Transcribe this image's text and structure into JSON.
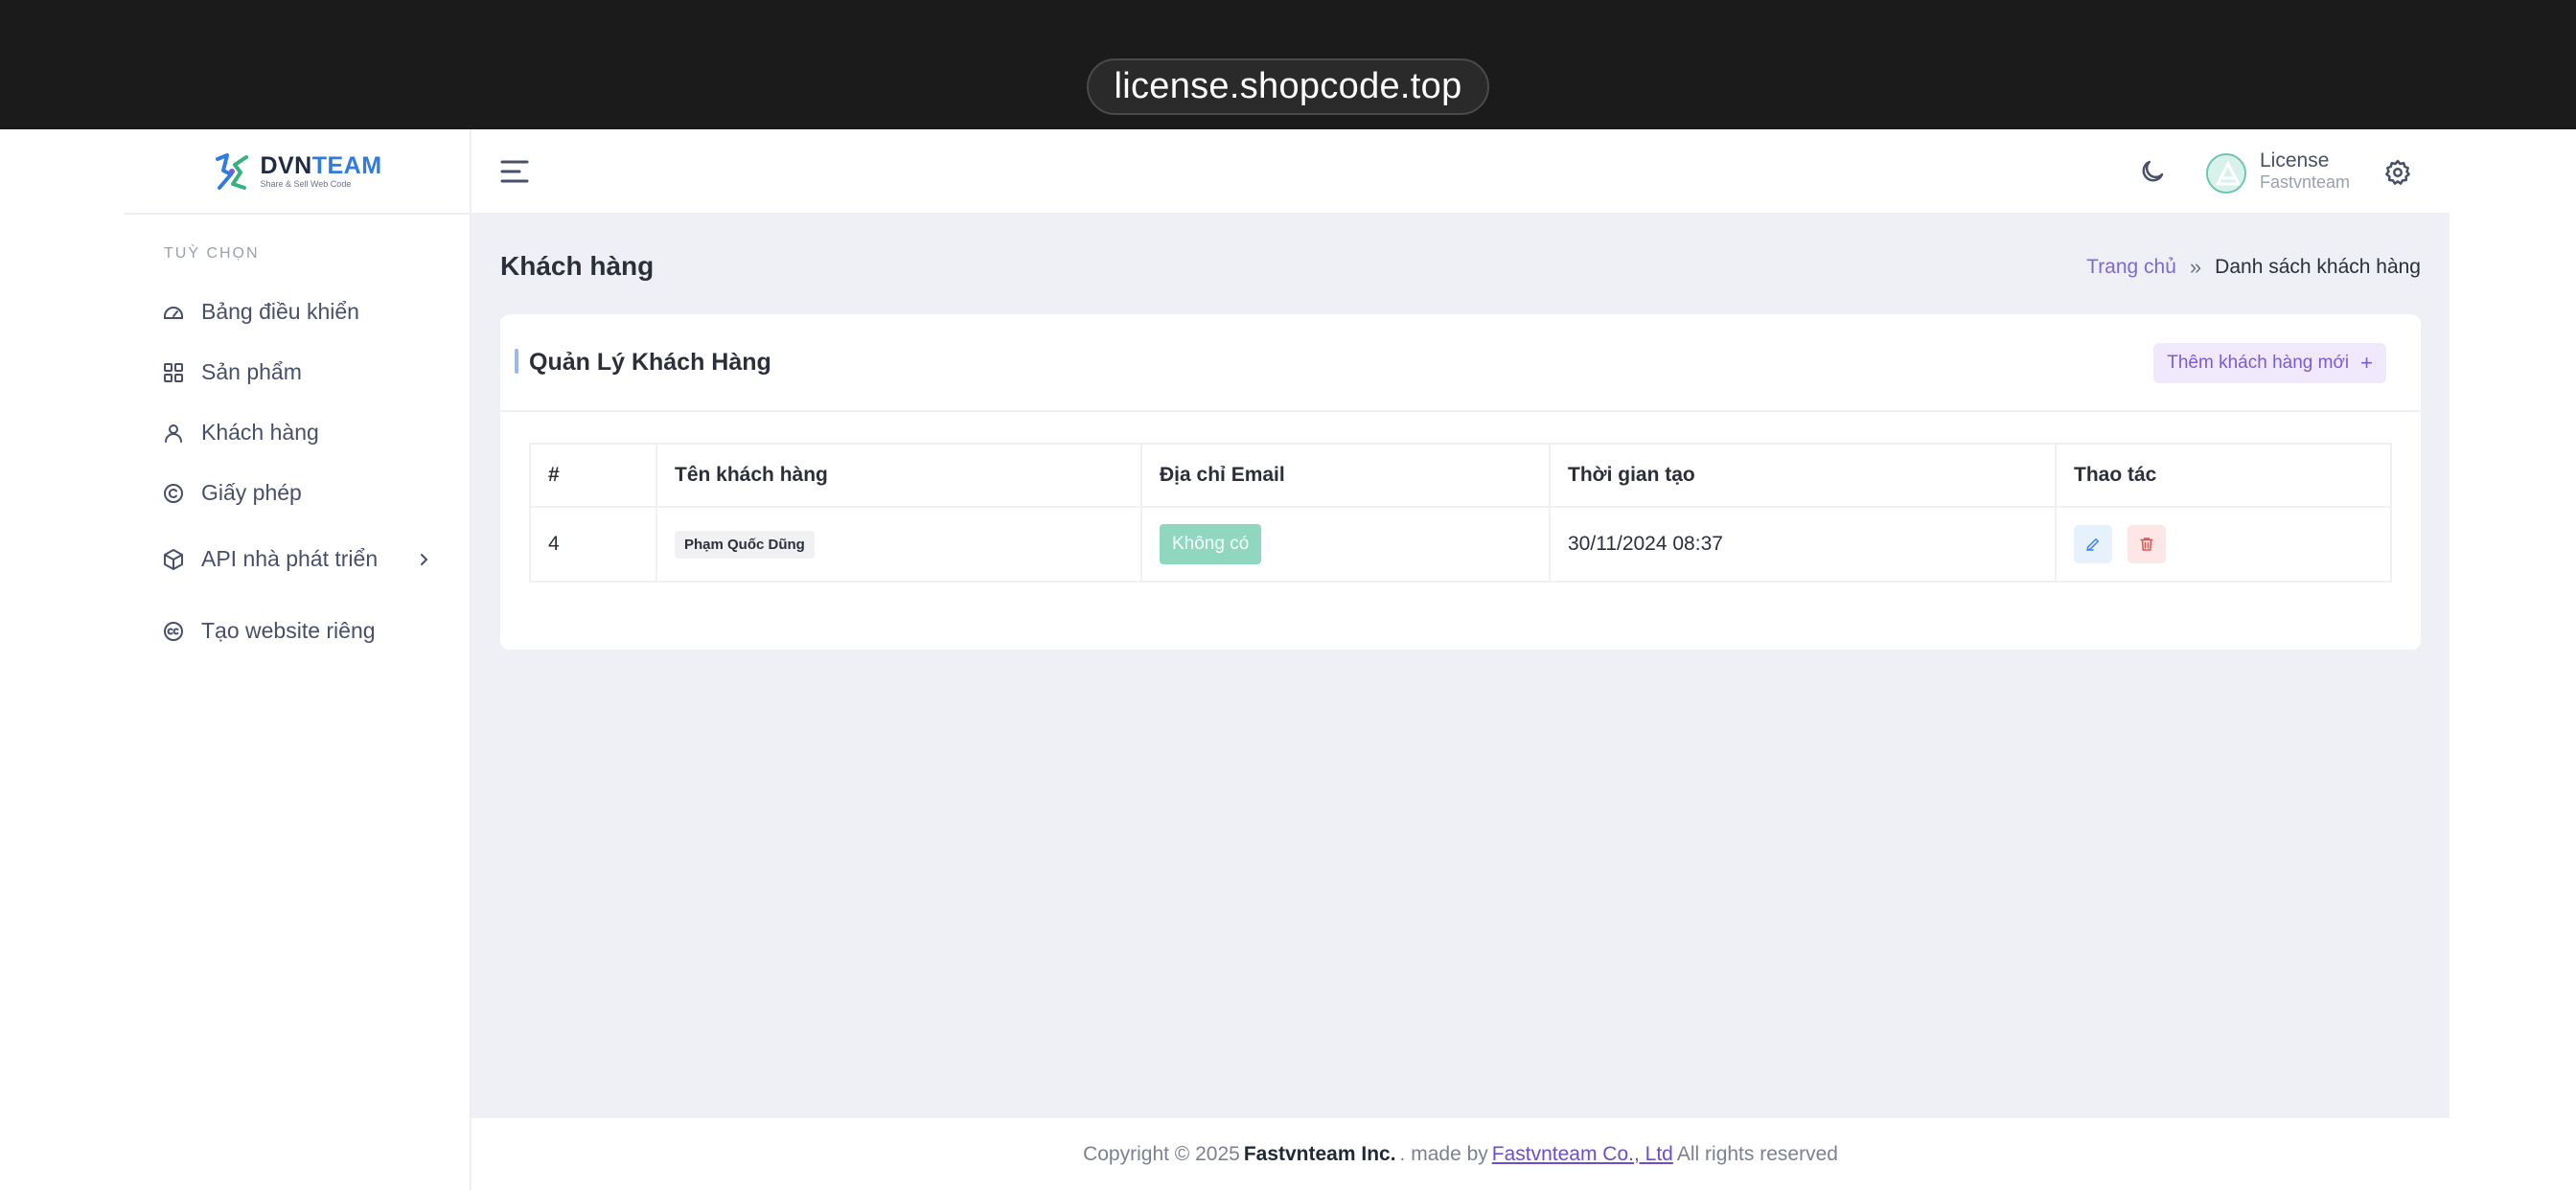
{
  "browser": {
    "url": "license.shopcode.top"
  },
  "brand": {
    "name_part1": "DVN",
    "name_part2": "TEAM",
    "tagline": "Share & Sell Web Code"
  },
  "sidebar": {
    "section_title": "TUỲ CHỌN",
    "items": [
      {
        "label": "Bảng điều khiển",
        "icon": "dashboard-icon"
      },
      {
        "label": "Sản phẩm",
        "icon": "grid-icon"
      },
      {
        "label": "Khách hàng",
        "icon": "user-icon"
      },
      {
        "label": "Giấy phép",
        "icon": "copyright-icon"
      },
      {
        "label": "API nhà phát triển",
        "icon": "cube-icon",
        "has_submenu": true
      },
      {
        "label": "Tạo website riêng",
        "icon": "creative-commons-icon"
      }
    ]
  },
  "header": {
    "user_name": "License",
    "user_org": "Fastvnteam"
  },
  "page": {
    "title": "Khách hàng",
    "breadcrumb_home": "Trang chủ",
    "breadcrumb_separator": "»",
    "breadcrumb_current": "Danh sách khách hàng"
  },
  "card": {
    "title": "Quản Lý Khách Hàng",
    "add_button": "Thêm khách hàng mới",
    "add_icon": "+"
  },
  "table": {
    "columns": [
      "#",
      "Tên khách hàng",
      "Địa chỉ Email",
      "Thời gian tạo",
      "Thao tác"
    ],
    "rows": [
      {
        "id": "4",
        "name": "Phạm Quốc Dũng",
        "email": "Không có",
        "created": "30/11/2024 08:37"
      }
    ]
  },
  "footer": {
    "prefix": "Copyright © 2025",
    "company": "Fastvnteam Inc.",
    "mid": ". made by",
    "link": "Fastvnteam Co., Ltd",
    "suffix": "All rights reserved"
  },
  "colors": {
    "accent": "#7c5ad4",
    "email_badge": "#8fd8bf",
    "content_bg": "#eff0f6",
    "topbar_bg": "#1b1b1b"
  }
}
